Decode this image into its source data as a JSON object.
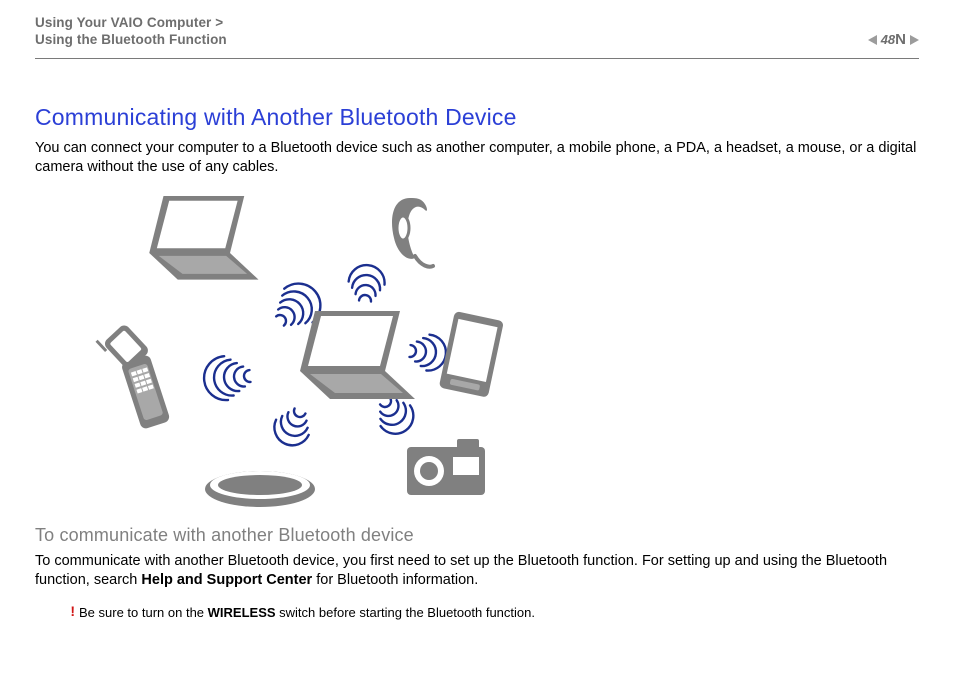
{
  "header": {
    "breadcrumb_line1": "Using Your VAIO Computer >",
    "breadcrumb_line2": "Using the Bluetooth Function",
    "page_number": "48"
  },
  "title": "Communicating with Another Bluetooth Device",
  "intro": "You can connect your computer to a Bluetooth device such as another computer, a mobile phone, a PDA, a headset, a mouse, or a digital camera without the use of any cables.",
  "subhead": "To communicate with another Bluetooth device",
  "para2_a": "To communicate with another Bluetooth device, you first need to set up the Bluetooth function. For setting up and using the Bluetooth function, search ",
  "para2_bold": "Help and Support Center",
  "para2_b": " for Bluetooth information.",
  "note_prefix": "Be sure to turn on the ",
  "note_bold": "WIRELESS",
  "note_suffix": " switch before starting the Bluetooth function.",
  "illustration": {
    "devices": [
      "laptop-second",
      "headset",
      "pda",
      "camera",
      "mouse",
      "flip-phone"
    ],
    "center": "laptop-center"
  }
}
